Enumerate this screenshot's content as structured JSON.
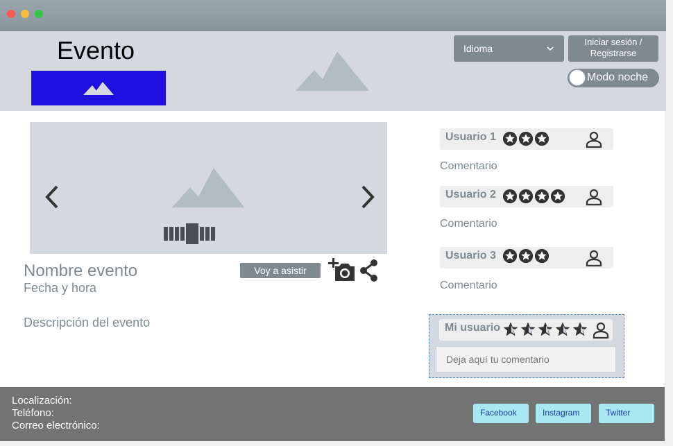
{
  "window": {
    "controls": [
      "close",
      "minimize",
      "maximize"
    ]
  },
  "header": {
    "title": "Evento",
    "language_select": {
      "value": "Idioma"
    },
    "login_button": {
      "line1": "Iniciar sesión /",
      "line2": "Registrarse"
    },
    "night_mode": {
      "label": "Modo noche",
      "enabled": false
    }
  },
  "event": {
    "name": "Nombre evento",
    "datetime": "Fecha y hora",
    "description": "Descripción del evento",
    "attend_label": "Voy a asistir",
    "carousel": {
      "slides": 8,
      "active_index": 4
    }
  },
  "comments": [
    {
      "user": "Usuario 1",
      "stars": 3,
      "text": "Comentario"
    },
    {
      "user": "Usuario 2",
      "stars": 4,
      "text": "Comentario"
    },
    {
      "user": "Usuario 3",
      "stars": 3,
      "text": "Comentario"
    }
  ],
  "my_comment": {
    "user": "Mi usuario",
    "stars": 5,
    "placeholder": "Deja aquí tu comentario"
  },
  "footer": {
    "location_label": "Localización:",
    "phone_label": "Teléfono:",
    "email_label": "Correo electrónico:",
    "social": [
      "Facebook",
      "Instagram",
      "Twitter"
    ]
  },
  "colors": {
    "header_bg": "#d3d9de",
    "accent_gray": "#7f8a90",
    "logo_blue": "#1e0fe0",
    "footer_bg": "#737373",
    "social_bg": "#a8e8f2"
  }
}
